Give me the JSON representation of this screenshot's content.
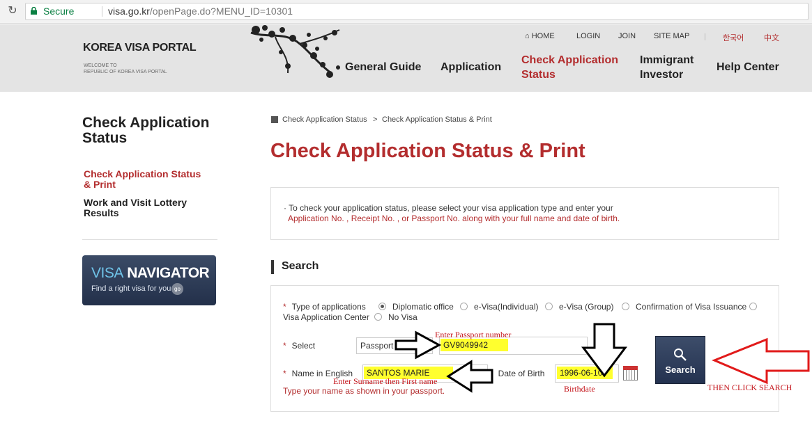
{
  "browser": {
    "secure_label": "Secure",
    "url_host": "visa.go.kr",
    "url_path": "/openPage.do?MENU_ID=10301"
  },
  "header": {
    "logo_title": "KOREA VISA PORTAL",
    "logo_sub1": "WELCOME TO",
    "logo_sub2": "REPUBLIC OF KOREA VISA PORTAL",
    "util": {
      "home": "HOME",
      "login": "LOGIN",
      "join": "JOIN",
      "sitemap": "SITE MAP",
      "korean": "한국어",
      "chinese": "中文"
    },
    "menu": {
      "general_guide": "General Guide",
      "application": "Application",
      "check_status_1": "Check Application",
      "check_status_2": "Status",
      "immigrant_1": "Immigrant",
      "immigrant_2": "Investor",
      "help": "Help Center"
    }
  },
  "sidebar": {
    "title_1": "Check Application",
    "title_2": "Status",
    "items": [
      {
        "line1": "Check Application Status",
        "line2": "& Print"
      },
      {
        "line1": "Work and Visit Lottery",
        "line2": "Results"
      }
    ],
    "navigator": {
      "word1": "VISA",
      "word2": "NAVIGATOR",
      "tagline": "Find a right visa for you",
      "go": "go"
    }
  },
  "main": {
    "breadcrumb": {
      "item1": "Check Application Status",
      "sep": ">",
      "item2": "Check Application Status & Print"
    },
    "title": "Check Application Status & Print",
    "info_line1": "· To check your application status, please select your visa application type and enter your",
    "info_line2": "Application No. , Receipt No. , or Passport No. along with your full name and date of birth.",
    "search_heading": "Search",
    "form": {
      "type_label": "Type of applications",
      "types": [
        "Diplomatic office",
        "e-Visa(Individual)",
        "e-Visa (Group)",
        "Confirmation of Visa Issuance",
        "Visa Application Center",
        "No Visa"
      ],
      "selected_type": "Diplomatic office",
      "select_label": "Select",
      "select_value": "Passport No.",
      "passport_value": "GV9049942",
      "name_label": "Name in English",
      "name_value": "SANTOS MARIE",
      "dob_label": "Date of Birth",
      "dob_value": "1996-06-10",
      "search_button": "Search",
      "name_note": "Type your name as shown in your passport.",
      "required_mark": "*"
    }
  },
  "annotations": {
    "passport": "Enter Passport number",
    "name": "Enter Surname then First name",
    "dob": "Birthdate",
    "click": "THEN CLICK SEARCH"
  }
}
